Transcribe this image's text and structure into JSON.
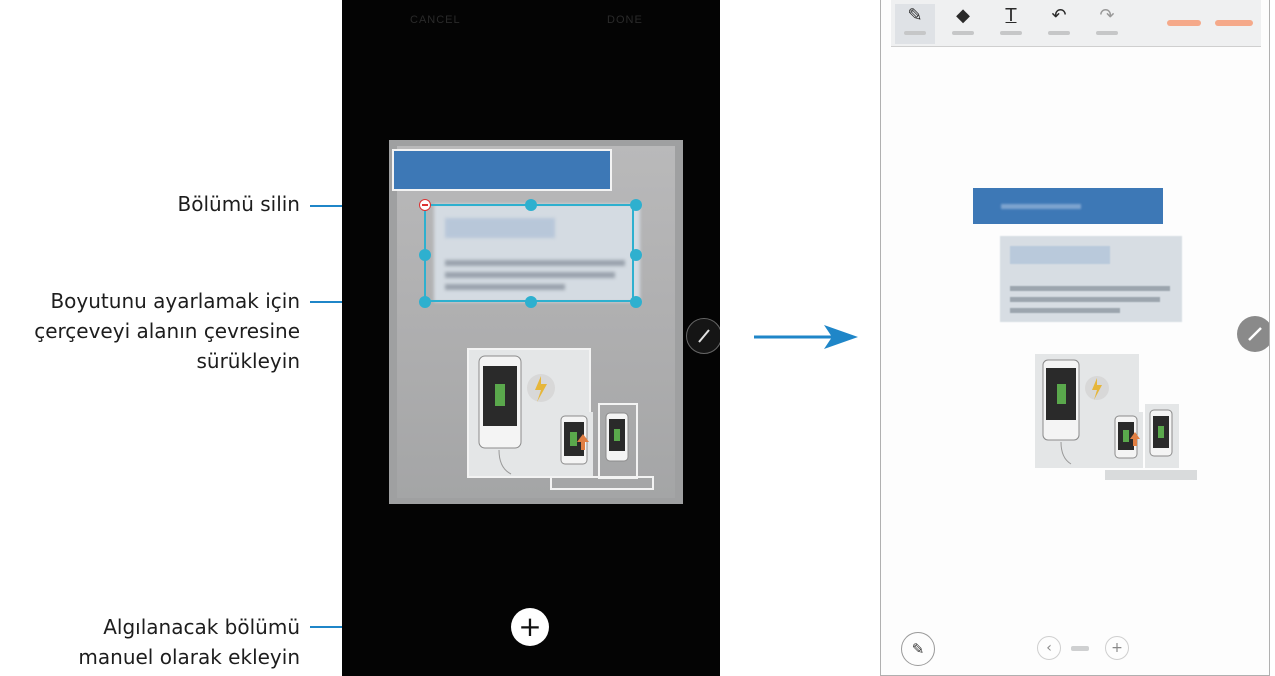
{
  "callouts": {
    "delete_section": "Bölümü silin",
    "resize_line1": "Boyutunu ayarlamak için",
    "resize_line2": "çerçeveyi alanın çevresine",
    "resize_line3": "sürükleyin",
    "add_manual_line1": "Algılanacak bölümü",
    "add_manual_line2": "manuel olarak ekleyin"
  },
  "left_screen": {
    "cancel_label": "CANCEL",
    "done_label": "DONE",
    "add_icon": "plus-icon",
    "edit_icon": "pencil-icon",
    "remove_icon": "minus-circle-icon"
  },
  "right_screen": {
    "tools": [
      {
        "icon": "pen-icon",
        "glyph": "✎"
      },
      {
        "icon": "eraser-icon",
        "glyph": "◆"
      },
      {
        "icon": "text-icon",
        "glyph": "T"
      },
      {
        "icon": "undo-icon",
        "glyph": "↶"
      },
      {
        "icon": "redo-icon",
        "glyph": "↷"
      }
    ],
    "prev_glyph": "‹",
    "add_page_glyph": "+",
    "edit_icon": "pencil-icon",
    "pen-settings-icon": "pen-star-icon"
  },
  "colors": {
    "accent_blue": "#1f86c8",
    "handle_cyan": "#2eb0cf",
    "banner_blue": "#3d78b6",
    "toolbar_orange": "#f5a98a"
  }
}
